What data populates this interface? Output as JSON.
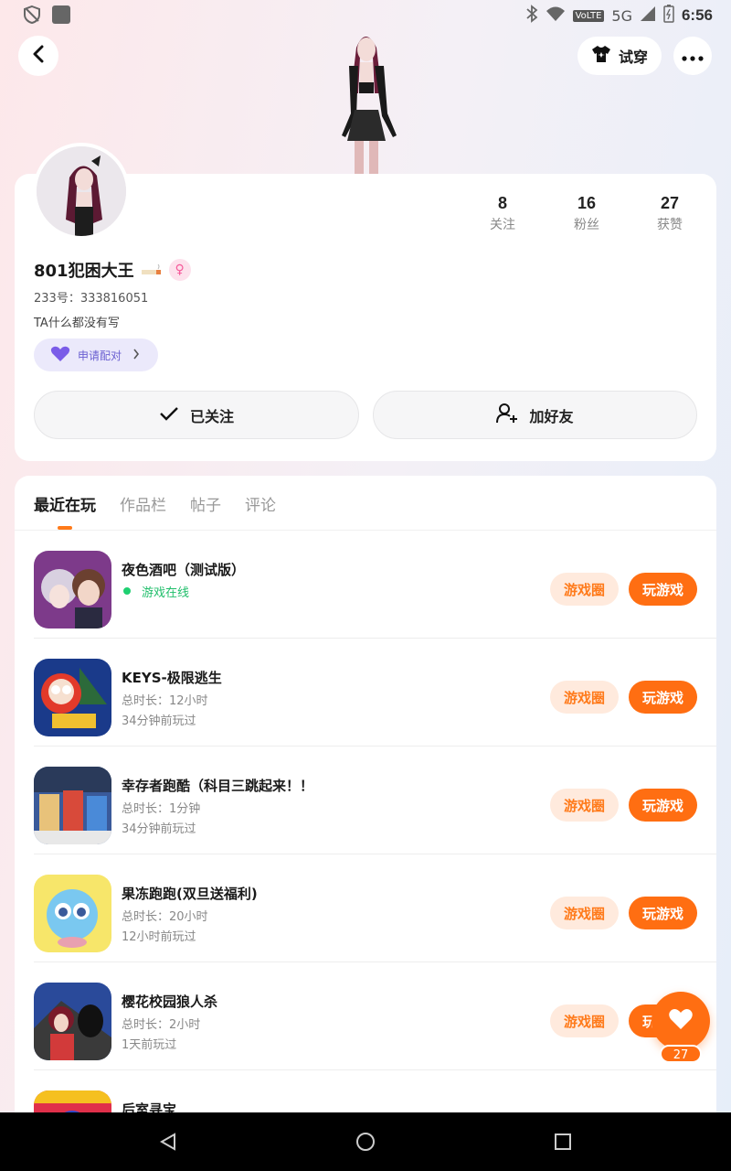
{
  "status_bar": {
    "network": "5G",
    "volte": "VoLTE",
    "time": "6:56"
  },
  "header": {
    "tryon_label": "试穿"
  },
  "profile": {
    "name": "801犯困大王",
    "gender_symbol": "♀",
    "uid": "233号：333816051",
    "bio": "TA什么都没有写",
    "pair_label": "申请配对",
    "stats": [
      {
        "value": "8",
        "label": "关注"
      },
      {
        "value": "16",
        "label": "粉丝"
      },
      {
        "value": "27",
        "label": "获赞"
      }
    ],
    "follow_label": "已关注",
    "add_friend_label": "加好友"
  },
  "tabs": [
    "最近在玩",
    "作品栏",
    "帖子",
    "评论"
  ],
  "games": [
    {
      "title": "夜色酒吧（测试版）",
      "status": "游戏在线",
      "icon_colors": [
        "#7d3a8a",
        "#c47db8"
      ]
    },
    {
      "title": "KEYS-极限逃生",
      "duration": "总时长：12小时",
      "last_played": "34分钟前玩过",
      "icon_colors": [
        "#1a3a8a",
        "#e23a2a"
      ]
    },
    {
      "title": "幸存者跑酷（科目三跳起来！！",
      "duration": "总时长：1分钟",
      "last_played": "34分钟前玩过",
      "icon_colors": [
        "#3a5a9a",
        "#e8c27a"
      ]
    },
    {
      "title": "果冻跑跑(双旦送福利)",
      "duration": "总时长：20小时",
      "last_played": "12小时前玩过",
      "icon_colors": [
        "#f7e66a",
        "#7ac8f0"
      ]
    },
    {
      "title": "樱花校园狼人杀",
      "duration": "总时长：2小时",
      "last_played": "1天前玩过",
      "icon_colors": [
        "#2a4a9a",
        "#d23a3a"
      ]
    },
    {
      "title": "后室寻宝",
      "icon_colors": [
        "#e0304a",
        "#f5c020"
      ]
    }
  ],
  "game_buttons": {
    "circle": "游戏圈",
    "play": "玩游戏"
  },
  "like_count": "27",
  "colors": {
    "accent": "#ff6e12",
    "accent_light": "#ffeadd",
    "online": "#1fd071"
  }
}
